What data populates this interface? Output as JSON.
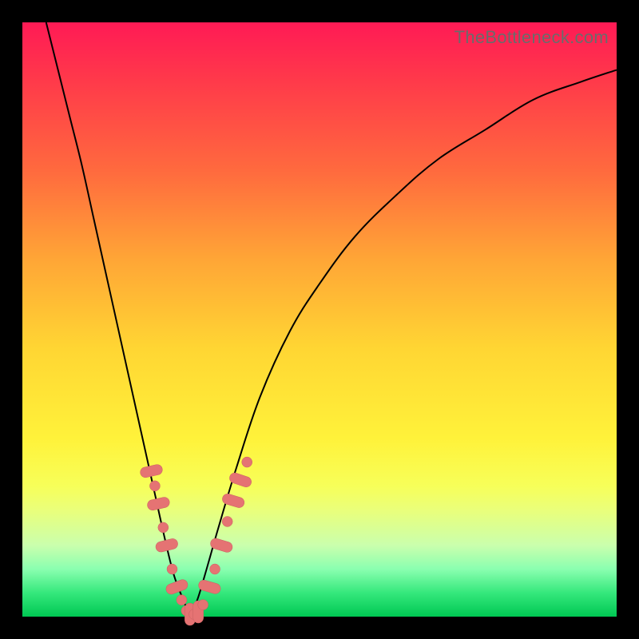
{
  "watermark": "TheBottleneck.com",
  "colors": {
    "dot_fill": "#e57373",
    "dot_stroke": "#c96262",
    "curve": "#000000",
    "frame": "#000000"
  },
  "chart_data": {
    "type": "line",
    "title": "",
    "xlabel": "",
    "ylabel": "",
    "xlim": [
      0,
      100
    ],
    "ylim": [
      0,
      100
    ],
    "grid": false,
    "legend": false,
    "series": [
      {
        "name": "left-branch",
        "x": [
          4,
          6,
          8,
          10,
          12,
          14,
          16,
          18,
          20,
          22,
          24,
          25.5,
          27,
          28.2
        ],
        "y": [
          100,
          92,
          84,
          76,
          67,
          58,
          49,
          40,
          31,
          22,
          13,
          7,
          3,
          0
        ]
      },
      {
        "name": "right-branch",
        "x": [
          28.2,
          29.5,
          31,
          33,
          36,
          40,
          45,
          50,
          56,
          63,
          70,
          78,
          86,
          94,
          100
        ],
        "y": [
          0,
          3,
          8,
          15,
          25,
          37,
          48,
          56,
          64,
          71,
          77,
          82,
          87,
          90,
          92
        ]
      }
    ],
    "highlight_clusters": [
      {
        "branch": "left",
        "points": [
          {
            "x": 21.7,
            "y": 24.5,
            "shape": "pill"
          },
          {
            "x": 22.3,
            "y": 22.0,
            "shape": "dot"
          },
          {
            "x": 22.9,
            "y": 19.0,
            "shape": "pill"
          },
          {
            "x": 23.7,
            "y": 15.0,
            "shape": "dot"
          },
          {
            "x": 24.3,
            "y": 12.0,
            "shape": "pill"
          },
          {
            "x": 25.2,
            "y": 8.0,
            "shape": "dot"
          },
          {
            "x": 26.0,
            "y": 5.0,
            "shape": "pill"
          },
          {
            "x": 26.8,
            "y": 2.8,
            "shape": "dot"
          }
        ]
      },
      {
        "branch": "valley",
        "points": [
          {
            "x": 27.6,
            "y": 1.0,
            "shape": "dot"
          },
          {
            "x": 28.2,
            "y": 0.4,
            "shape": "pill"
          },
          {
            "x": 28.9,
            "y": 0.4,
            "shape": "dot"
          },
          {
            "x": 29.6,
            "y": 0.8,
            "shape": "pill"
          },
          {
            "x": 30.4,
            "y": 2.0,
            "shape": "dot"
          }
        ]
      },
      {
        "branch": "right",
        "points": [
          {
            "x": 31.5,
            "y": 5.0,
            "shape": "pill"
          },
          {
            "x": 32.4,
            "y": 8.0,
            "shape": "dot"
          },
          {
            "x": 33.5,
            "y": 12.0,
            "shape": "pill"
          },
          {
            "x": 34.5,
            "y": 16.0,
            "shape": "dot"
          },
          {
            "x": 35.5,
            "y": 19.5,
            "shape": "pill"
          },
          {
            "x": 36.7,
            "y": 23.0,
            "shape": "pill"
          },
          {
            "x": 37.8,
            "y": 26.0,
            "shape": "dot"
          }
        ]
      }
    ]
  }
}
